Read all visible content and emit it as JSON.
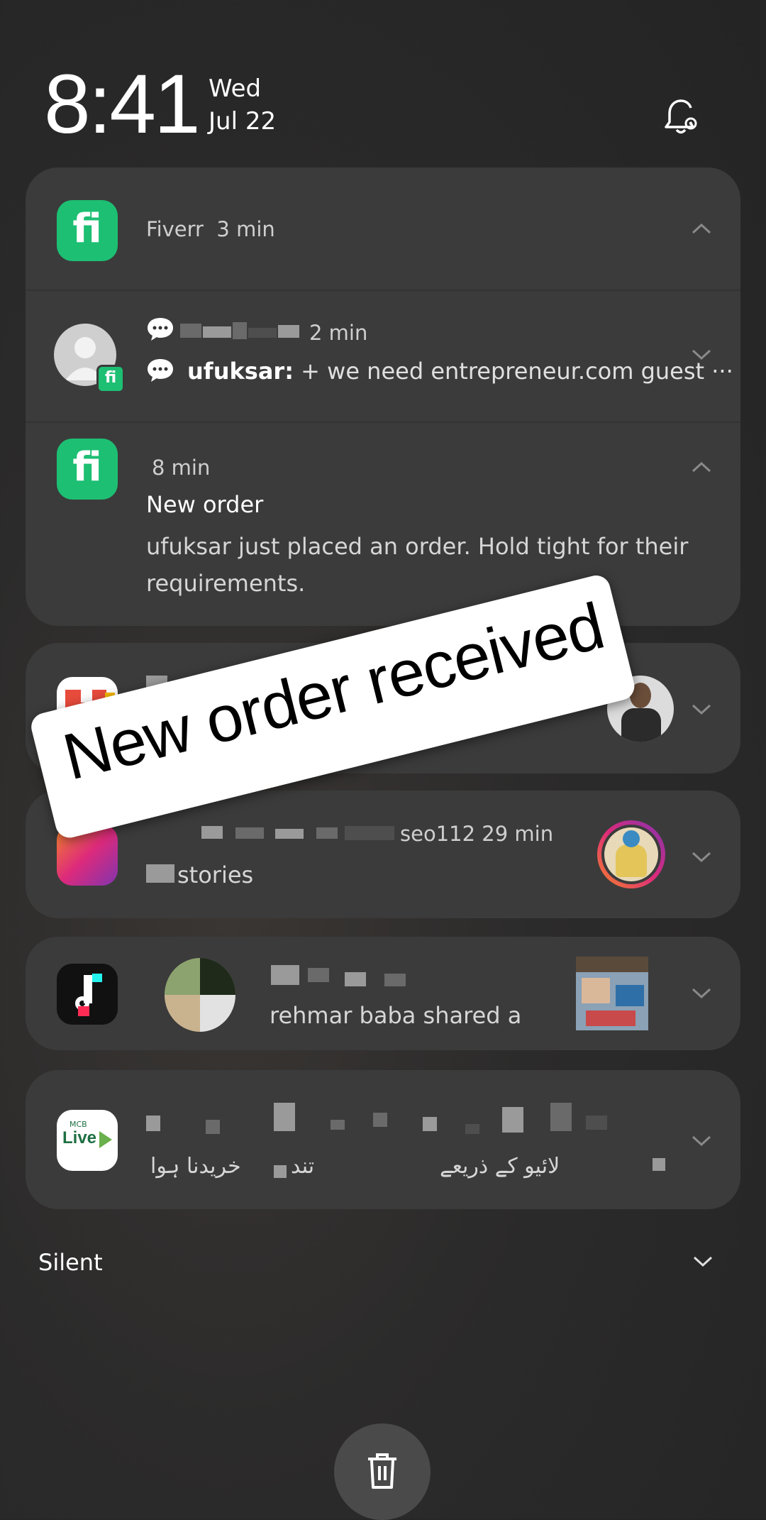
{
  "clock": {
    "time": "8:41",
    "weekday": "Wed",
    "date": "Jul 22"
  },
  "fiverr_card": {
    "header": {
      "app_name": "Fiverr",
      "time": "3 min"
    },
    "chat": {
      "sender_time": "2 min",
      "message_prefix": "ufuksar:",
      "message": "+ we need entrepreneur.com guest ···"
    },
    "order": {
      "time": "8 min",
      "title": "New order",
      "body": "ufuksar just placed an order. Hold tight for their requirements."
    }
  },
  "instagram_card": {
    "time_suffix": "seo112  29 min",
    "body": "stories"
  },
  "tiktok_card": {
    "body": "rehmar  baba shared a"
  },
  "urdu_card": {
    "body_right": "لائیو کے ذریعے",
    "body_mid": "تند",
    "body_left": "خریدنا ہوا",
    "icon_label": "Live",
    "icon_sublabel": "MCB"
  },
  "overlay": {
    "text": "New order received"
  },
  "silent": {
    "label": "Silent"
  },
  "icons": [
    "bell-settings-icon",
    "chevron-up-icon",
    "chevron-down-icon",
    "chat-bubble-icon",
    "trash-icon"
  ],
  "colors": {
    "fiverr_green": "#1dbf73",
    "card_bg": "#3b3b3b",
    "background": "#2a2a2a"
  }
}
